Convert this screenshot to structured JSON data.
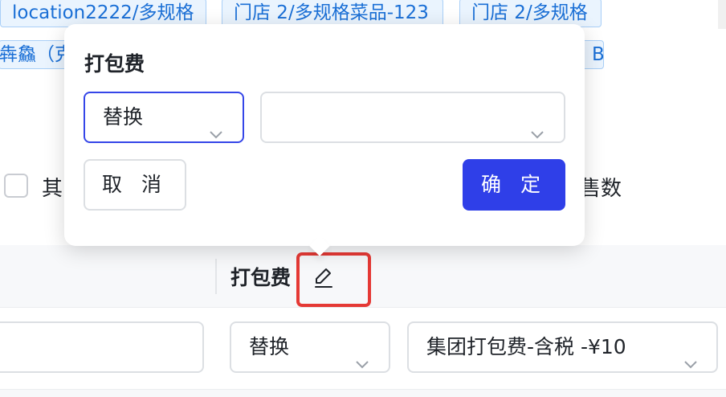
{
  "tags": [
    "location2222/多规格",
    "门店 2/多规格菜品-123",
    "门店 2/多规格",
    "犇鱻（克",
    "B"
  ],
  "filter": {
    "checkbox_label": "其",
    "sales_label": "售数"
  },
  "popover": {
    "title": "打包费",
    "mode_select": "替换",
    "value_select": "",
    "cancel_label": "取 消",
    "ok_label": "确 定"
  },
  "table": {
    "column_title": "打包费",
    "row": {
      "input_value": "",
      "mode_select": "替换",
      "fee_select": "集团打包费-含税 -¥10"
    }
  },
  "colors": {
    "primary": "#2f3fe8",
    "tag_text": "#1a6fd6",
    "highlight": "#e53935"
  }
}
